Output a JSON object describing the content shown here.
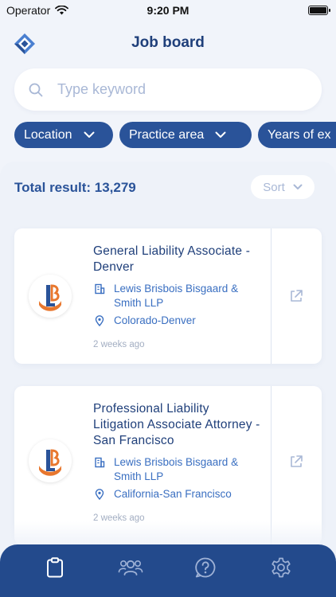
{
  "status_bar": {
    "carrier": "Operator",
    "time": "9:20 PM"
  },
  "header": {
    "title": "Job board"
  },
  "search": {
    "placeholder": "Type keyword",
    "value": ""
  },
  "filters": [
    {
      "label": "Location"
    },
    {
      "label": "Practice area"
    },
    {
      "label": "Years of ex"
    }
  ],
  "results": {
    "total_label": "Total result: 13,279",
    "sort_label": "Sort"
  },
  "jobs": [
    {
      "title": "General Liability Associate - Denver",
      "company": "Lewis Brisbois Bisgaard & Smith LLP",
      "location": "Colorado-Denver",
      "posted": "2 weeks ago"
    },
    {
      "title": "Professional Liability Litigation Associate Attorney - San Francisco",
      "company": "Lewis Brisbois Bisgaard & Smith LLP",
      "location": "California-San Francisco",
      "posted": "2 weeks ago"
    }
  ],
  "bottom_nav": [
    {
      "icon": "clipboard-icon",
      "active": true
    },
    {
      "icon": "people-icon",
      "active": false
    },
    {
      "icon": "help-icon",
      "active": false
    },
    {
      "icon": "gear-icon",
      "active": false
    }
  ],
  "colors": {
    "primary": "#2a5399",
    "nav_bg": "#234a8c",
    "title": "#1f3f7a",
    "link": "#3a6fc1",
    "muted": "#a3aec2",
    "logo_orange": "#e8772e"
  }
}
